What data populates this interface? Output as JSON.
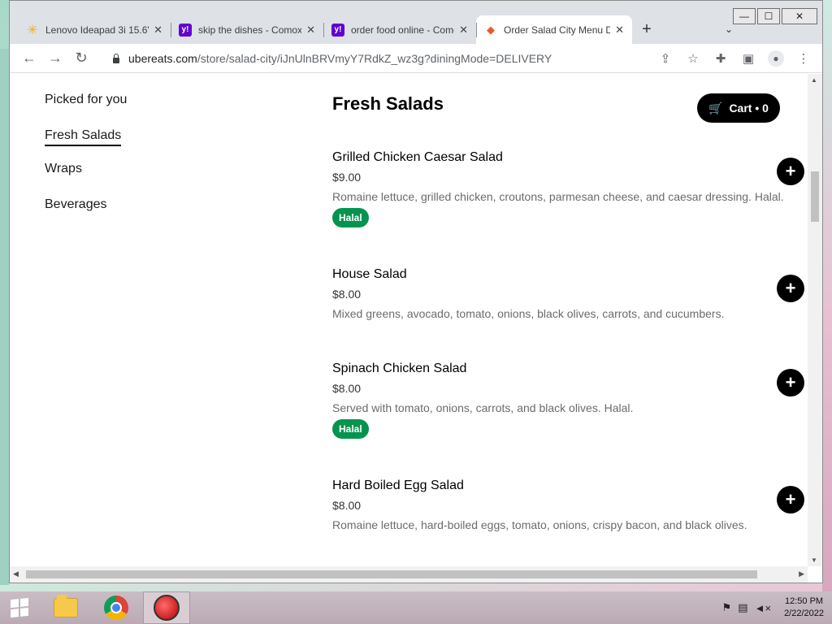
{
  "browser": {
    "tabs": [
      {
        "title": "Lenovo Ideapad 3i 15.6\"",
        "icon": "walmart-spark-icon",
        "active": false
      },
      {
        "title": "skip the dishes - Comox",
        "icon": "yahoo-icon",
        "active": false
      },
      {
        "title": "order food online - Comox",
        "icon": "yahoo-icon",
        "active": false
      },
      {
        "title": "Order Salad City Menu Delivery",
        "icon": "pizza-icon",
        "active": true
      }
    ],
    "url_host": "ubereats.com",
    "url_rest": "/store/salad-city/iJnUlnBRVmyY7RdkZ_wz3g?diningMode=DELIVERY",
    "window_controls": {
      "minimize": "—",
      "maximize": "☐",
      "close": "✕"
    }
  },
  "sidenav": {
    "items": [
      {
        "label": "Picked for you"
      },
      {
        "label": "Fresh Salads",
        "active": true
      },
      {
        "label": "Wraps"
      },
      {
        "label": "Beverages"
      }
    ]
  },
  "section": {
    "title": "Fresh Salads"
  },
  "cart": {
    "label": "Cart • 0"
  },
  "menu_items": [
    {
      "name": "Grilled Chicken Caesar Salad",
      "price": "$9.00",
      "description": "Romaine lettuce, grilled chicken, croutons, parmesan cheese, and caesar dressing. Halal.",
      "badge": "Halal"
    },
    {
      "name": "House Salad",
      "price": "$8.00",
      "description": "Mixed greens, avocado, tomato, onions, black olives, carrots, and cucumbers.",
      "badge": ""
    },
    {
      "name": "Spinach Chicken Salad",
      "price": "$8.00",
      "description": "Served with tomato, onions, carrots, and black olives. Halal.",
      "badge": "Halal"
    },
    {
      "name": "Hard Boiled Egg Salad",
      "price": "$8.00",
      "description": "Romaine lettuce, hard-boiled eggs, tomato, onions, crispy bacon, and black olives.",
      "badge": ""
    }
  ],
  "taskbar": {
    "time": "12:50 PM",
    "date": "2/22/2022"
  },
  "colors": {
    "halal_badge": "#05944f",
    "accent_black": "#000000"
  }
}
